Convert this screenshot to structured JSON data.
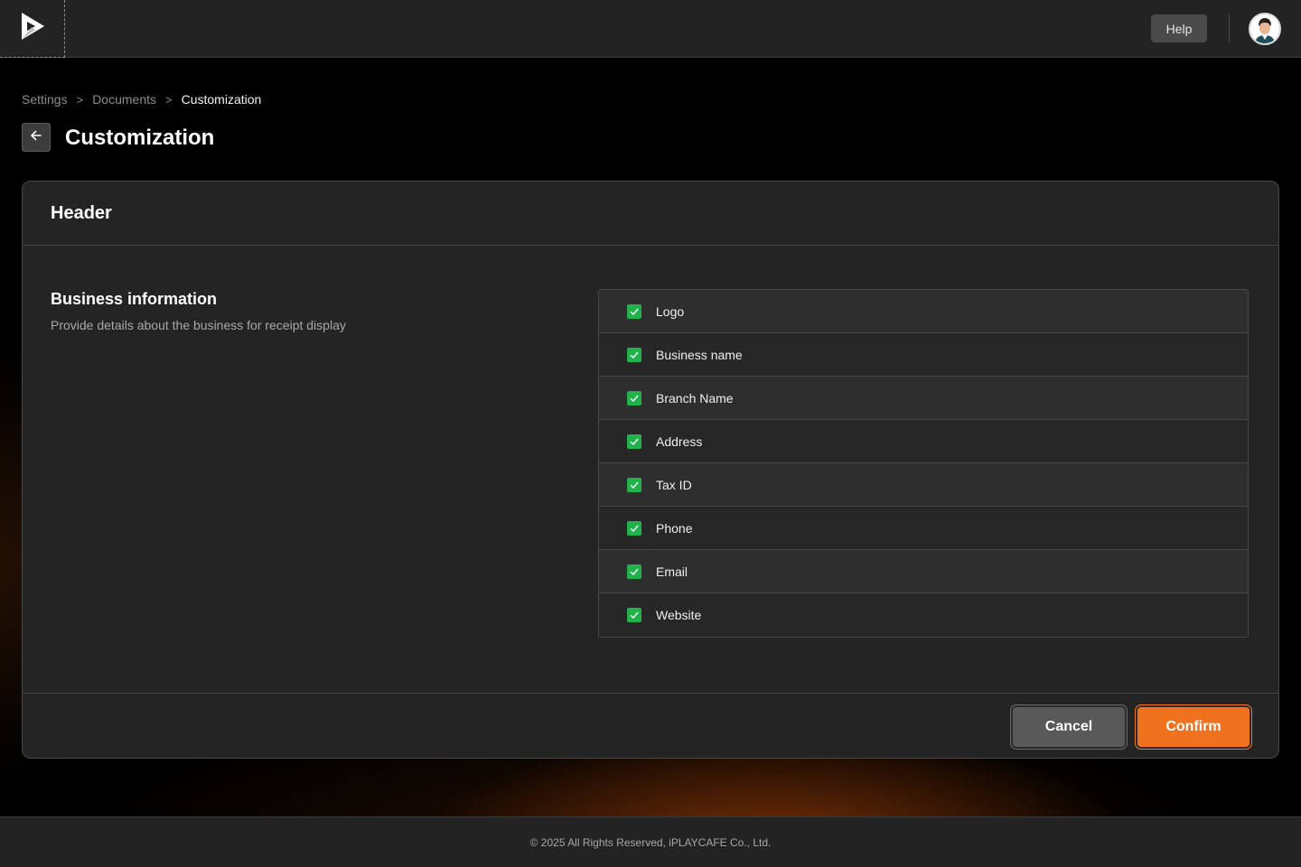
{
  "topbar": {
    "logo_icon": "play-logo-icon",
    "help_label": "Help",
    "avatar_icon": "user-avatar"
  },
  "breadcrumb": {
    "items": [
      "Settings",
      "Documents",
      "Customization"
    ],
    "separator": ">"
  },
  "page": {
    "back_icon": "arrow-left-icon",
    "title": "Customization"
  },
  "card": {
    "title": "Header",
    "section": {
      "title": "Business information",
      "description": "Provide details about the business for receipt display"
    },
    "options": [
      {
        "label": "Logo",
        "checked": true
      },
      {
        "label": "Business name",
        "checked": true
      },
      {
        "label": "Branch Name",
        "checked": true
      },
      {
        "label": "Address",
        "checked": true
      },
      {
        "label": "Tax ID",
        "checked": true
      },
      {
        "label": "Phone",
        "checked": true
      },
      {
        "label": "Email",
        "checked": true
      },
      {
        "label": "Website",
        "checked": true
      }
    ],
    "cancel_label": "Cancel",
    "confirm_label": "Confirm"
  },
  "footer": {
    "copyright": "© 2025 All Rights Reserved, iPLAYCAFE Co., Ltd."
  },
  "colors": {
    "accent": "#f0721f",
    "check": "#22b24c",
    "surface": "#262626",
    "topbar": "#232323"
  }
}
